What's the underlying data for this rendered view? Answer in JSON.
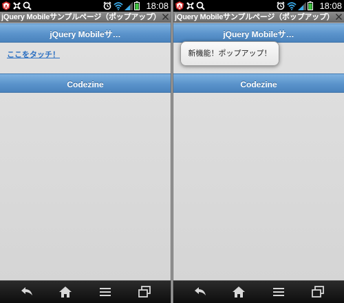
{
  "status_bar": {
    "time": "18:08"
  },
  "window": {
    "title": "jQuery Mobileサンプルページ（ポップアップ）"
  },
  "header": {
    "title": "jQuery Mobileサ…"
  },
  "footer": {
    "title": "Codezine"
  },
  "content": {
    "touch_link": "ここをタッチ！"
  },
  "popup": {
    "text": "新機能！ポップアップ！"
  },
  "colors": {
    "header_blue": "#5a93cb",
    "link_blue": "#2a6fc2",
    "navbar": "#1a1a1a"
  },
  "icons": [
    "antivirus-icon",
    "usb-debug-icon",
    "search-icon",
    "alarm-icon",
    "wifi-icon",
    "signal-icon",
    "battery-icon",
    "close-icon",
    "back-icon",
    "home-icon",
    "menu-icon",
    "recent-apps-icon"
  ]
}
